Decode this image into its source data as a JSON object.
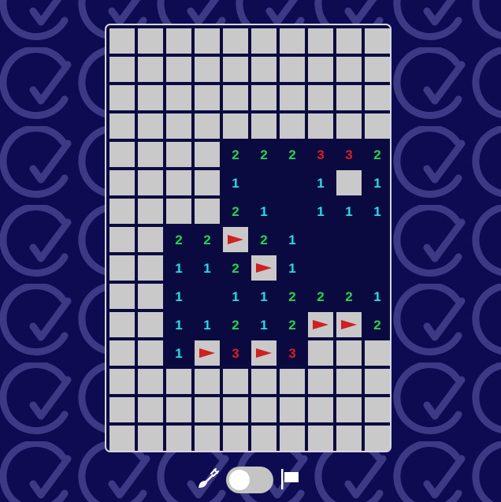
{
  "theme": {
    "hidden_color": "#c9c9c9",
    "flag_color": "#d21f1f",
    "number_colors": {
      "1": "#1ee0e6",
      "2": "#1ed84a",
      "3": "#e11c1c"
    }
  },
  "board": {
    "columns": 10,
    "rows": [
      "##########",
      "##########",
      "##########",
      "##########",
      "####222332",
      "####1..1#1",
      "####21.111",
      "##22F21...",
      "##112F1...",
      "##1.112221",
      "##11212FF2",
      "##1F3F3###",
      "##########",
      "##########",
      "##########"
    ]
  },
  "controls": {
    "mode_icons": [
      "shovel-icon",
      "flag-icon"
    ],
    "flag_mode_on": false
  }
}
